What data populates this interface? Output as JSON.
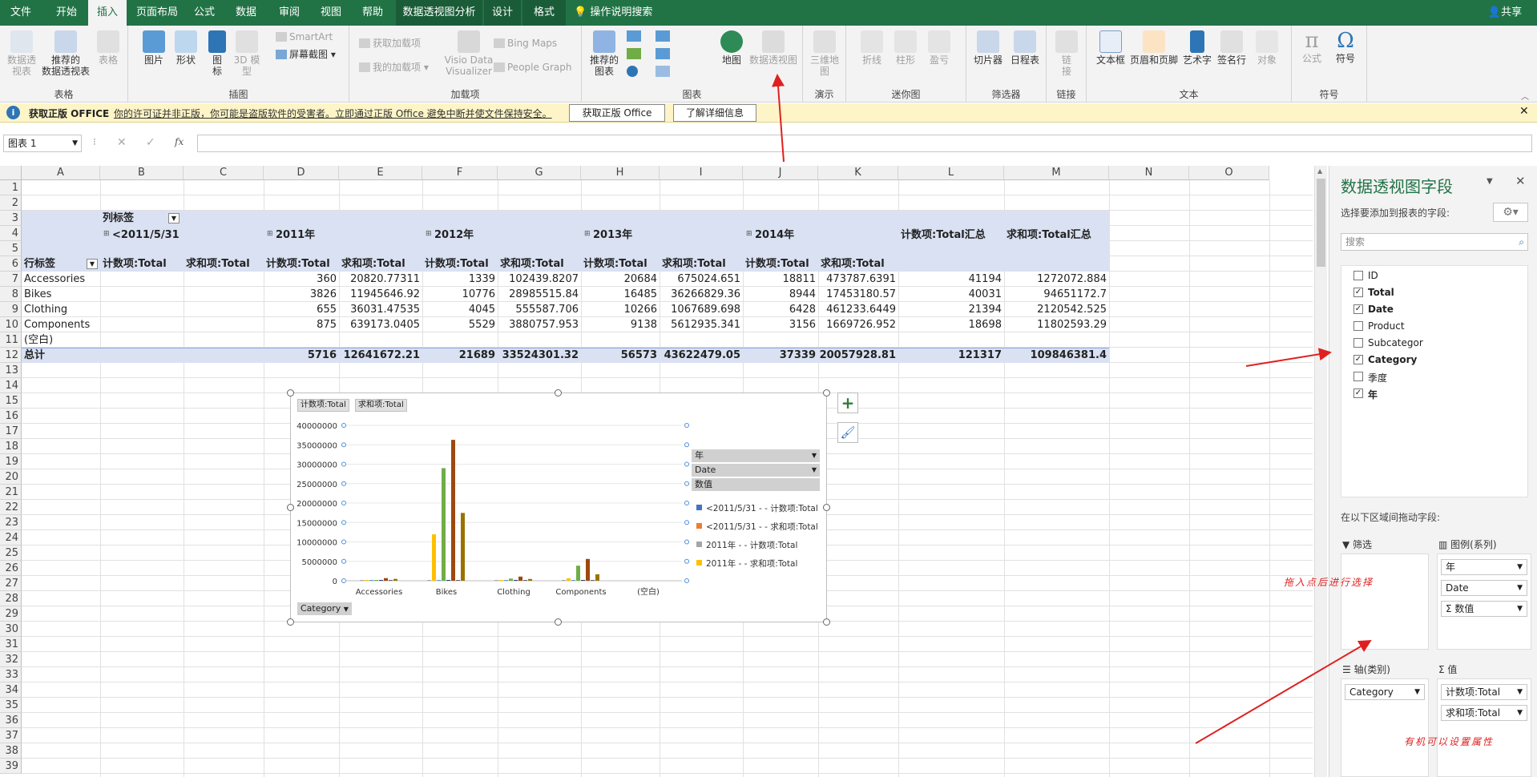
{
  "tabs": [
    "文件",
    "开始",
    "插入",
    "页面布局",
    "公式",
    "数据",
    "审阅",
    "视图",
    "帮助",
    "数据透视图分析",
    "设计",
    "格式",
    "操作说明搜索"
  ],
  "share": "共享",
  "ribbon": {
    "table": {
      "label": "表格",
      "pivot": "数据透\n视表",
      "rec_pivot": "推荐的\n数据透视表",
      "tbl": "表格"
    },
    "illus": {
      "label": "插图",
      "pic": "图片",
      "shape": "形状",
      "icon": "图\n标",
      "model3d": "3D 模\n型",
      "smartart": "SmartArt",
      "screenshot": "屏幕截图"
    },
    "addins": {
      "label": "加载项",
      "get": "获取加载项",
      "mine": "我的加载项",
      "visio": "Visio Data\nVisualizer",
      "bing": "Bing Maps",
      "people": "People Graph"
    },
    "charts": {
      "label": "图表",
      "rec": "推荐的\n图表",
      "map": "地图",
      "pivotchart": "数据透视图"
    },
    "tours": {
      "label": "演示",
      "map3d": "三维地\n图"
    },
    "spark": {
      "label": "迷你图",
      "line": "折线",
      "col": "柱形",
      "wl": "盈亏"
    },
    "filters": {
      "label": "筛选器",
      "slicer": "切片器",
      "timeline": "日程表"
    },
    "links": {
      "label": "链接",
      "link": "链\n接"
    },
    "text": {
      "label": "文本",
      "textbox": "文本框",
      "hf": "页眉和页脚",
      "wordart": "艺术字",
      "sig": "签名行",
      "obj": "对象"
    },
    "symbols": {
      "label": "符号",
      "eq": "公式",
      "sym": "符号"
    }
  },
  "msg": {
    "title": "获取正版 OFFICE",
    "text": "你的许可证并非正版，你可能是盗版软件的受害者。立即通过正版 Office 避免中断并使文件保持安全。",
    "btn1": "获取正版 Office",
    "btn2": "了解详细信息"
  },
  "formula": {
    "namebox": "图表 1",
    "fx": "fx"
  },
  "columns": [
    "A",
    "B",
    "C",
    "D",
    "E",
    "F",
    "G",
    "H",
    "I",
    "J",
    "K",
    "L",
    "M",
    "N",
    "O"
  ],
  "rows": [
    "1",
    "2",
    "3",
    "4",
    "5",
    "6",
    "7",
    "8",
    "9",
    "10",
    "11",
    "12",
    "13",
    "14",
    "15",
    "16",
    "17",
    "18",
    "19",
    "20",
    "21",
    "22",
    "23",
    "24",
    "25",
    "26",
    "27",
    "28",
    "29",
    "30",
    "31",
    "32",
    "33",
    "34",
    "35",
    "36",
    "37",
    "38",
    "39"
  ],
  "pivot": {
    "col_label": "列标签",
    "years": [
      "<2011/5/31",
      "2011年",
      "2012年",
      "2013年",
      "2014年"
    ],
    "grand_count": "计数项:Total汇总",
    "grand_sum": "求和项:Total汇总",
    "row_label": "行标签",
    "measures": [
      "计数项:Total",
      "求和项:Total",
      "计数项:Total",
      "求和项:Total",
      "计数项:Total",
      "求和项:Total",
      "计数项:Total",
      "求和项:Total",
      "计数项:Total",
      "求和项:Total"
    ],
    "data": [
      {
        "label": "Accessories",
        "vals": [
          "",
          "",
          "360",
          "20820.77311",
          "1339",
          "102439.8207",
          "20684",
          "675024.651",
          "18811",
          "473787.6391",
          "41194",
          "1272072.884"
        ]
      },
      {
        "label": "Bikes",
        "vals": [
          "",
          "",
          "3826",
          "11945646.92",
          "10776",
          "28985515.84",
          "16485",
          "36266829.36",
          "8944",
          "17453180.57",
          "40031",
          "94651172.7"
        ]
      },
      {
        "label": "Clothing",
        "vals": [
          "",
          "",
          "655",
          "36031.47535",
          "4045",
          "555587.706",
          "10266",
          "1067689.698",
          "6428",
          "461233.6449",
          "21394",
          "2120542.525"
        ]
      },
      {
        "label": "Components",
        "vals": [
          "",
          "",
          "875",
          "639173.0405",
          "5529",
          "3880757.953",
          "9138",
          "5612935.341",
          "3156",
          "1669726.952",
          "18698",
          "11802593.29"
        ]
      },
      {
        "label": "(空白)",
        "vals": [
          "",
          "",
          "",
          "",
          "",
          "",
          "",
          "",
          "",
          "",
          "",
          ""
        ]
      }
    ],
    "total": {
      "label": "总计",
      "vals": [
        "",
        "",
        "5716",
        "12641672.21",
        "21689",
        "33524301.32",
        "56573",
        "43622479.05",
        "37339",
        "20057928.81",
        "121317",
        "109846381.4"
      ]
    }
  },
  "chart_data": {
    "type": "bar",
    "filter_buttons": [
      "计数项:Total",
      "求和项:Total"
    ],
    "axis_button": "Category",
    "categories": [
      "Accessories",
      "Bikes",
      "Clothing",
      "Components",
      "(空白)"
    ],
    "yticks": [
      "40000000",
      "35000000",
      "30000000",
      "25000000",
      "20000000",
      "15000000",
      "10000000",
      "5000000",
      "0"
    ],
    "ylim": [
      0,
      40000000
    ],
    "legend_fields": [
      "年",
      "Date",
      "数值"
    ],
    "legend": [
      "<2011/5/31 - - 计数项:Total",
      "<2011/5/31 - - 求和项:Total",
      "2011年 - - 计数项:Total",
      "2011年 - - 求和项:Total"
    ],
    "colors": [
      "#4472c4",
      "#ed7d31",
      "#a5a5a5",
      "#ffc000",
      "#70ad47",
      "#9e480e",
      "#997300"
    ],
    "series": [
      {
        "values": [
          360,
          3826,
          655,
          875,
          0
        ],
        "color": "#a5a5a5"
      },
      {
        "values": [
          20820,
          11945647,
          36031,
          639173,
          0
        ],
        "color": "#ffc000"
      },
      {
        "values": [
          1339,
          10776,
          4045,
          5529,
          0
        ],
        "color": "#5b9bd5"
      },
      {
        "values": [
          102440,
          28985516,
          555588,
          3880758,
          0
        ],
        "color": "#70ad47"
      },
      {
        "values": [
          20684,
          16485,
          10266,
          9138,
          0
        ],
        "color": "#264478"
      },
      {
        "values": [
          675025,
          36266829,
          1067690,
          5612935,
          0
        ],
        "color": "#9e480e"
      },
      {
        "values": [
          18811,
          8944,
          6428,
          3156,
          0
        ],
        "color": "#636363"
      },
      {
        "values": [
          473788,
          17453181,
          461234,
          1669727,
          0
        ],
        "color": "#997300"
      }
    ]
  },
  "pane": {
    "title": "数据透视图字段",
    "subtitle": "选择要添加到报表的字段:",
    "search": "搜索",
    "fields": [
      {
        "name": "ID",
        "checked": false
      },
      {
        "name": "Total",
        "checked": true
      },
      {
        "name": "Date",
        "checked": true
      },
      {
        "name": "Product",
        "checked": false
      },
      {
        "name": "Subcategor",
        "checked": false
      },
      {
        "name": "Category",
        "checked": true
      },
      {
        "name": "季度",
        "checked": false
      },
      {
        "name": "年",
        "checked": true
      }
    ],
    "drag_hint": "在以下区域间拖动字段:",
    "filter": "筛选",
    "legend": "图例(系列)",
    "axis": "轴(类别)",
    "values": "值",
    "legend_items": [
      "年",
      "Date",
      "Σ 数值"
    ],
    "axis_items": [
      "Category"
    ],
    "value_items": [
      "计数项:Total",
      "求和项:Total"
    ]
  },
  "annotations": {
    "a1": "拖入点后进行选择",
    "a2": "有机可以设置属性"
  }
}
